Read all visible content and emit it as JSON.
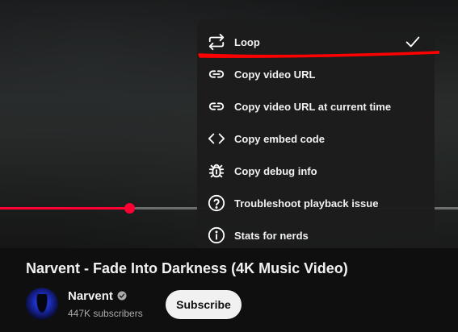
{
  "player": {
    "progress_percent": 28.3
  },
  "context_menu": {
    "items": [
      {
        "label": "Loop",
        "icon": "loop-icon",
        "checked": true
      },
      {
        "label": "Copy video URL",
        "icon": "link-icon"
      },
      {
        "label": "Copy video URL at current time",
        "icon": "link-icon"
      },
      {
        "label": "Copy embed code",
        "icon": "code-icon"
      },
      {
        "label": "Copy debug info",
        "icon": "bug-icon"
      },
      {
        "label": "Troubleshoot playback issue",
        "icon": "help-circle-icon"
      },
      {
        "label": "Stats for nerds",
        "icon": "info-circle-icon"
      }
    ]
  },
  "video": {
    "title": "Narvent - Fade Into Darkness (4K Music Video)"
  },
  "channel": {
    "name": "Narvent",
    "subscribers": "447K subscribers",
    "verified": true
  },
  "subscribe": {
    "label": "Subscribe"
  },
  "colors": {
    "progress": "#ff0033",
    "annotation": "#ff0000",
    "menu_background": "#1c1c1c",
    "page_background": "#0f0f0f"
  }
}
